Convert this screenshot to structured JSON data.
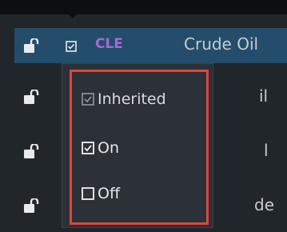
{
  "rows": [
    {
      "symbol": "CLE",
      "description": "Crude Oil"
    },
    {
      "partial_text": "il"
    },
    {
      "partial_text": "l"
    },
    {
      "partial_text": "de"
    }
  ],
  "menu": {
    "items": [
      {
        "label": "Inherited",
        "state": "inherited"
      },
      {
        "label": "On",
        "state": "checked"
      },
      {
        "label": "Off",
        "state": "unchecked"
      }
    ]
  },
  "colors": {
    "background": "#21262b",
    "selected_row": "#234d6b",
    "symbol": "#a56ad6",
    "highlight": "#e0453f",
    "menu_bg": "#2b3136"
  },
  "icons": [
    "lock-open-icon",
    "checkbox-checked-icon",
    "checkbox-inherited-icon",
    "checkbox-unchecked-icon"
  ]
}
